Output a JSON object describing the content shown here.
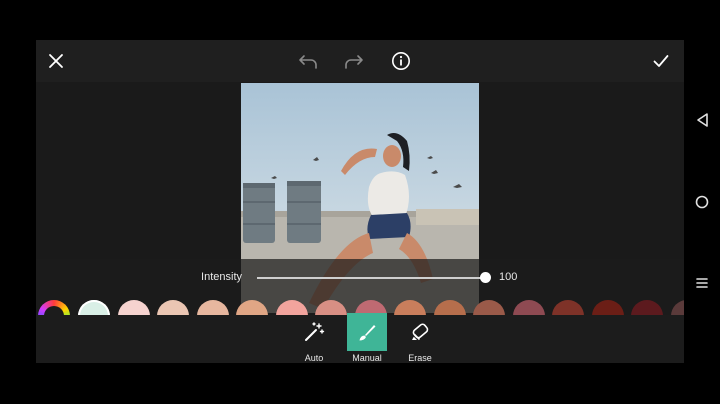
{
  "toolbar": {
    "close_icon": "close-icon",
    "undo_icon": "undo-icon",
    "redo_icon": "redo-icon",
    "info_icon": "info-icon",
    "apply_icon": "checkmark-icon"
  },
  "intensity": {
    "label": "Intensity",
    "value": "100",
    "level": 1.0
  },
  "color_swatches": [
    "#d9efe6",
    "#f6d3cf",
    "#ebc6b3",
    "#e7b79f",
    "#e0a685",
    "#f2a49d",
    "#d88f84",
    "#bf6a72",
    "#c97e5c",
    "#b66e4c",
    "#9a5a49",
    "#8e4a52",
    "#7e3228",
    "#6b1e16",
    "#5c1a1e",
    "#5a3a3a"
  ],
  "tools": [
    {
      "label": "Auto",
      "icon": "magic-wand-icon",
      "active": false
    },
    {
      "label": "Manual",
      "icon": "brush-icon",
      "active": true
    },
    {
      "label": "Erase",
      "icon": "eraser-icon",
      "active": false
    }
  ],
  "system_nav": {
    "back_icon": "back-triangle-icon",
    "home_icon": "home-circle-icon",
    "recents_icon": "recents-menu-icon"
  },
  "colors": {
    "accent": "#3fb597",
    "panel": "#1c1c1c"
  }
}
